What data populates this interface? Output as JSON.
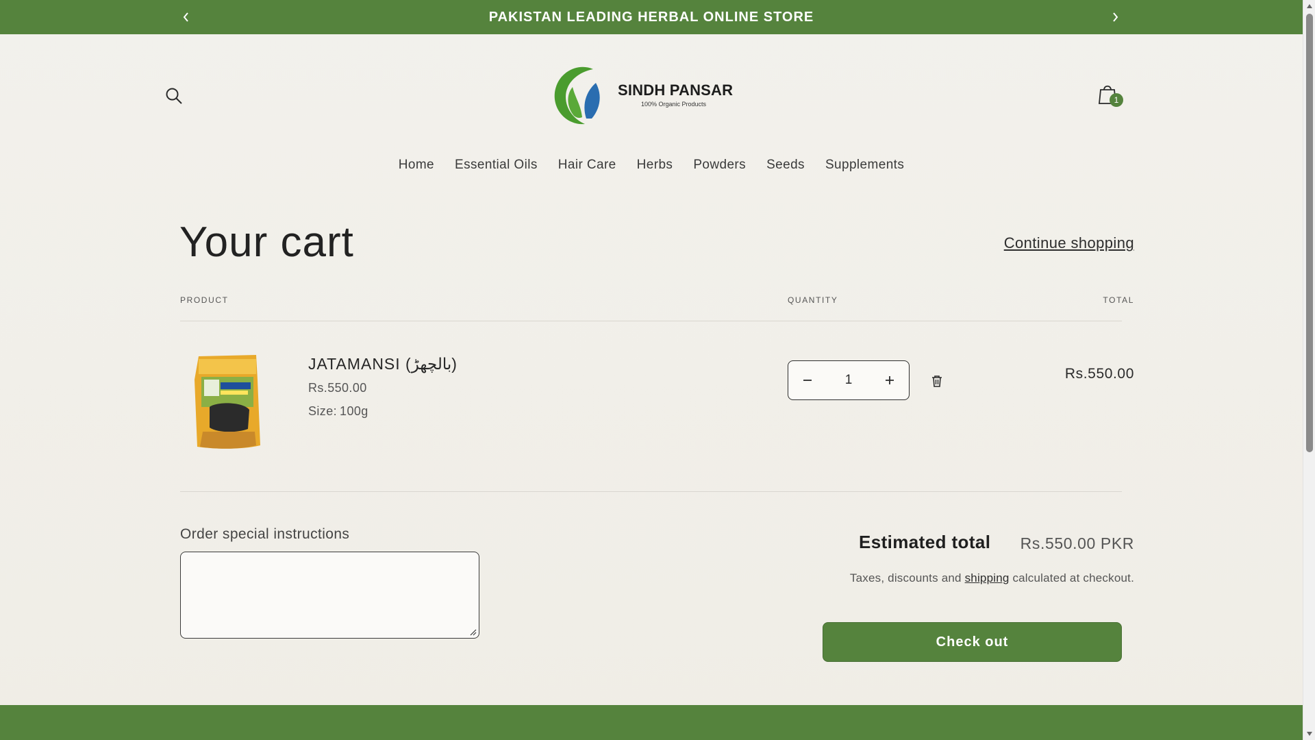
{
  "announcement": {
    "text": "PAKISTAN LEADING HERBAL ONLINE STORE"
  },
  "header": {
    "logo_name": "SINDH PANSAR",
    "logo_tagline": "100% Organic Products",
    "cart_count": "1"
  },
  "nav": {
    "items": [
      {
        "label": "Home"
      },
      {
        "label": "Essential Oils"
      },
      {
        "label": "Hair Care"
      },
      {
        "label": "Herbs"
      },
      {
        "label": "Powders"
      },
      {
        "label": "Seeds"
      },
      {
        "label": "Supplements"
      }
    ]
  },
  "cart": {
    "title": "Your cart",
    "continue_label": "Continue shopping",
    "columns": {
      "product": "PRODUCT",
      "quantity": "QUANTITY",
      "total": "TOTAL"
    },
    "items": [
      {
        "name": "JATAMANSI (بالچھڑ)",
        "price": "Rs.550.00",
        "size_label": "Size:",
        "size_value": "100g",
        "quantity": "1",
        "line_total": "Rs.550.00"
      }
    ]
  },
  "instructions": {
    "label": "Order special instructions",
    "value": ""
  },
  "summary": {
    "estimated_label": "Estimated total",
    "estimated_value": "Rs.550.00 PKR",
    "tax_before": "Taxes, discounts and ",
    "tax_link": "shipping",
    "tax_after": " calculated at checkout.",
    "checkout_label": "Check out"
  },
  "colors": {
    "brand_green": "#55833d",
    "background": "#f1efe9",
    "text": "#2a2a2a"
  },
  "icons": [
    "chevron-left-icon",
    "chevron-right-icon",
    "search-icon",
    "cart-bag-icon",
    "minus-icon",
    "plus-icon",
    "trash-icon"
  ]
}
